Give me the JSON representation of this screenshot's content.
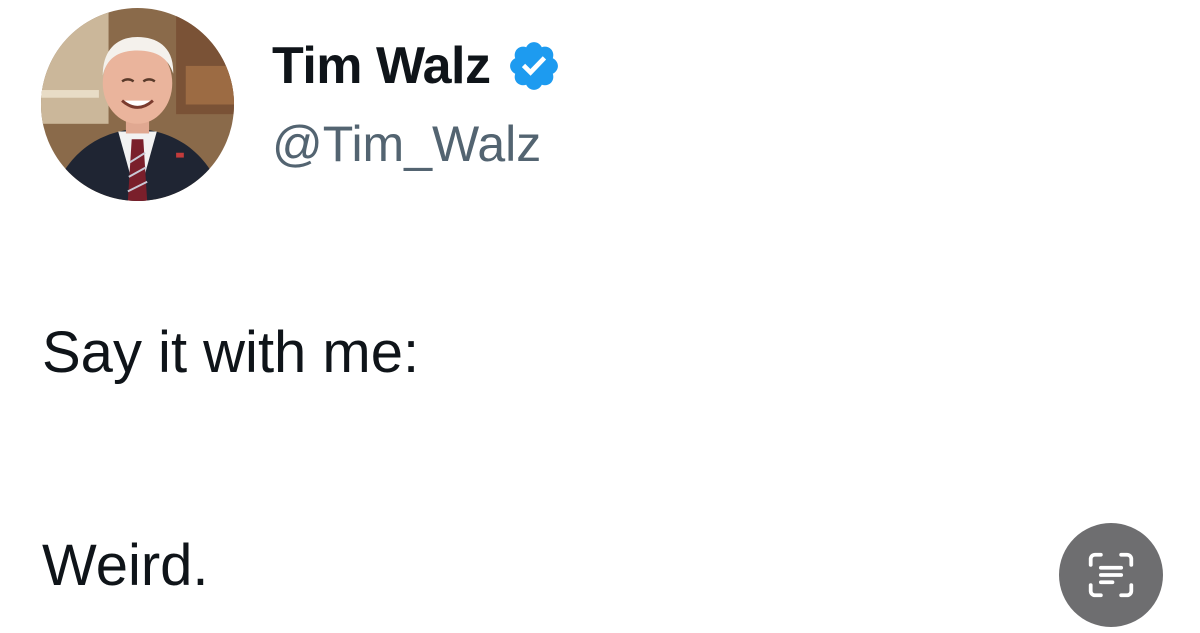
{
  "tweet": {
    "author": {
      "display_name": "Tim Walz",
      "handle": "@Tim_Walz",
      "verified": true,
      "avatar_icon": "profile-photo"
    },
    "lines": [
      "Say it with me:",
      "Weird."
    ]
  },
  "overlay": {
    "live_text_button_icon": "text-scan-icon"
  },
  "colors": {
    "primary_text": "#0f1419",
    "secondary_text": "#536471",
    "verified_blue": "#1d9bf0",
    "overlay_button": "#6e6e70",
    "background": "#ffffff"
  }
}
